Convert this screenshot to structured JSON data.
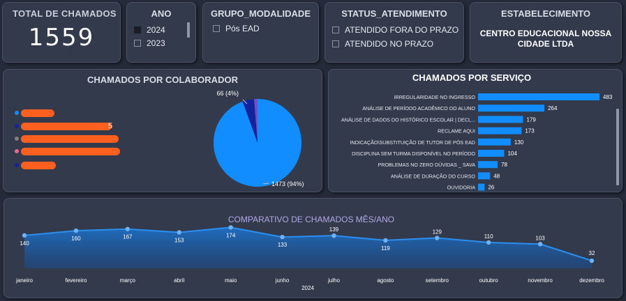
{
  "kpi": {
    "title": "TOTAL DE CHAMADOS",
    "value": "1559"
  },
  "ano": {
    "title": "ANO",
    "options": [
      {
        "label": "2024",
        "checked": true
      },
      {
        "label": "2023",
        "checked": false
      }
    ]
  },
  "grupo": {
    "title": "GRUPO_MODALIDADE",
    "options": [
      {
        "label": "Pós EAD",
        "checked": false
      }
    ]
  },
  "status": {
    "title": "STATUS_ATENDIMENTO",
    "options": [
      {
        "label": "ATENDIDO FORA DO PRAZO",
        "checked": false
      },
      {
        "label": "ATENDIDO NO PRAZO",
        "checked": false
      }
    ]
  },
  "estab": {
    "title": "ESTABELECIMENTO",
    "value_line1": "CENTRO EDUCACIONAL NOSSA",
    "value_line2": "CIDADE LTDA"
  },
  "colors": {
    "primary": "#118dff",
    "dark_blue": "#12239e",
    "orange_redaction": "#ff5f1f",
    "background": "#252b3a",
    "card": "#323a4c"
  },
  "chart_data": [
    {
      "type": "pie",
      "title": "CHAMADOS POR COLABORADOR",
      "slices": [
        {
          "label": "1473 (94%)",
          "value": 1473,
          "color": "#118dff"
        },
        {
          "label": "66 (4%)",
          "value": 66,
          "color": "#12239e"
        },
        {
          "label": "",
          "value": 20,
          "color": "#744ec2"
        }
      ],
      "legend": {
        "placement": "left",
        "entries_redacted": true,
        "dot_colors": [
          "#118dff",
          "#12239e",
          "#808080",
          "#e66c86",
          "#12239e"
        ],
        "partial_text": "5"
      }
    },
    {
      "type": "bar",
      "orientation": "horizontal",
      "title": "CHAMADOS POR SERVIÇO",
      "categories": [
        "IRREGULARIDADE NO INGRESSO",
        "ANÁLISE DE PERÍODO ACADÊMICO DO ALUNO",
        "ANÁLISE DE DADOS DO HISTÓRICO ESCOLAR | DECL...",
        "RECLAME AQUI",
        "INDICAÇÃO\\SUBSTITUIÇÃO DE TUTOR DE PÓS EAD",
        "DISCIPLINA SEM TURMA DISPONÍVEL NO PERÍODO",
        "PROBLEMAS NO ZERO DÚVIDAS _ SAVA",
        "ANÁLISE DE DURAÇÃO DO CURSO",
        "OUVIDORIA"
      ],
      "values": [
        483,
        264,
        179,
        173,
        130,
        104,
        78,
        48,
        26
      ],
      "xlim": [
        0,
        483
      ]
    },
    {
      "type": "area",
      "title": "COMPARATIVO DE CHAMADOS MÊS/ANO",
      "categories": [
        "janeiro",
        "fevereiro",
        "março",
        "abril",
        "maio",
        "junho",
        "julho",
        "agosto",
        "setembro",
        "outubro",
        "novembro",
        "dezembro"
      ],
      "values": [
        140,
        160,
        167,
        153,
        174,
        133,
        139,
        119,
        129,
        110,
        103,
        32
      ],
      "xlabel": "2024",
      "ylim": [
        0,
        190
      ]
    }
  ]
}
